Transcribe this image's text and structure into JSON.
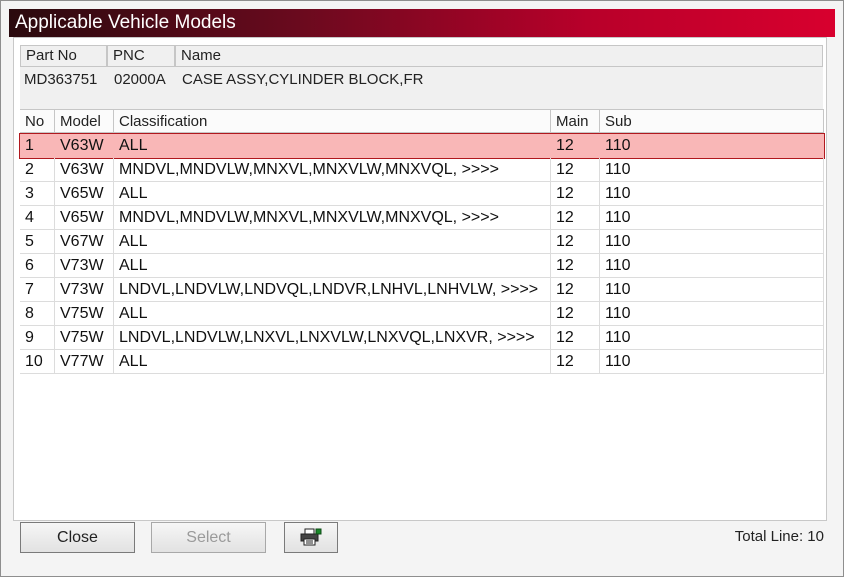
{
  "window": {
    "title": "Applicable Vehicle Models"
  },
  "part_info": {
    "headers": {
      "part_no": "Part No",
      "pnc": "PNC",
      "name": "Name"
    },
    "values": {
      "part_no": "MD363751",
      "pnc": "02000A",
      "name": "CASE ASSY,CYLINDER BLOCK,FR"
    }
  },
  "table": {
    "columns": {
      "no": "No",
      "model": "Model",
      "classification": "Classification",
      "main": "Main",
      "sub": "Sub"
    },
    "selected_index": 0,
    "rows": [
      {
        "no": "1",
        "model": "V63W",
        "classification": "ALL",
        "main": "12",
        "sub": "110"
      },
      {
        "no": "2",
        "model": "V63W",
        "classification": "MNDVL,MNDVLW,MNXVL,MNXVLW,MNXVQL,  >>>>",
        "main": "12",
        "sub": "110"
      },
      {
        "no": "3",
        "model": "V65W",
        "classification": "ALL",
        "main": "12",
        "sub": "110"
      },
      {
        "no": "4",
        "model": "V65W",
        "classification": "MNDVL,MNDVLW,MNXVL,MNXVLW,MNXVQL,  >>>>",
        "main": "12",
        "sub": "110"
      },
      {
        "no": "5",
        "model": "V67W",
        "classification": "ALL",
        "main": "12",
        "sub": "110"
      },
      {
        "no": "6",
        "model": "V73W",
        "classification": "ALL",
        "main": "12",
        "sub": "110"
      },
      {
        "no": "7",
        "model": "V73W",
        "classification": "LNDVL,LNDVLW,LNDVQL,LNDVR,LNHVL,LNHVLW,  >>>>",
        "main": "12",
        "sub": "110"
      },
      {
        "no": "8",
        "model": "V75W",
        "classification": "ALL",
        "main": "12",
        "sub": "110"
      },
      {
        "no": "9",
        "model": "V75W",
        "classification": "LNDVL,LNDVLW,LNXVL,LNXVLW,LNXVQL,LNXVR,  >>>>",
        "main": "12",
        "sub": "110"
      },
      {
        "no": "10",
        "model": "V77W",
        "classification": "ALL",
        "main": "12",
        "sub": "110"
      }
    ]
  },
  "footer": {
    "close_label": "Close",
    "select_label": "Select",
    "print_icon": "printer-icon",
    "total_text": "Total Line: 10"
  },
  "colors": {
    "title_gradient_start": "#2a0a0e",
    "title_gradient_end": "#d8002e",
    "selected_row_bg": "#f9b7b7",
    "selected_row_border": "#b0181e"
  }
}
